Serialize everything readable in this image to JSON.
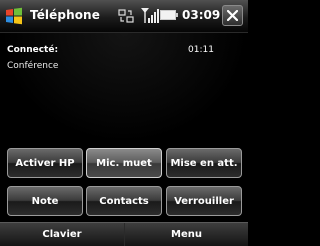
{
  "status_bar": {
    "app_title": "Téléphone",
    "time": "03:09",
    "close_label": "×",
    "icons": [
      "windows-logo-icon",
      "sync-icon",
      "signal-icon",
      "battery-icon",
      "close-icon"
    ]
  },
  "call": {
    "status": "Connecté:",
    "duration": "01:11",
    "name": "Conférence"
  },
  "buttons": {
    "row1": [
      "Activer HP",
      "Mic. muet",
      "Mise en att."
    ],
    "row2": [
      "Note",
      "Contacts",
      "Verrouiller"
    ]
  },
  "softkeys": {
    "left": "Clavier",
    "right": "Menu"
  },
  "colors": {
    "background": "#000000",
    "button_border": "#9a9a9a",
    "text": "#ffffff"
  }
}
